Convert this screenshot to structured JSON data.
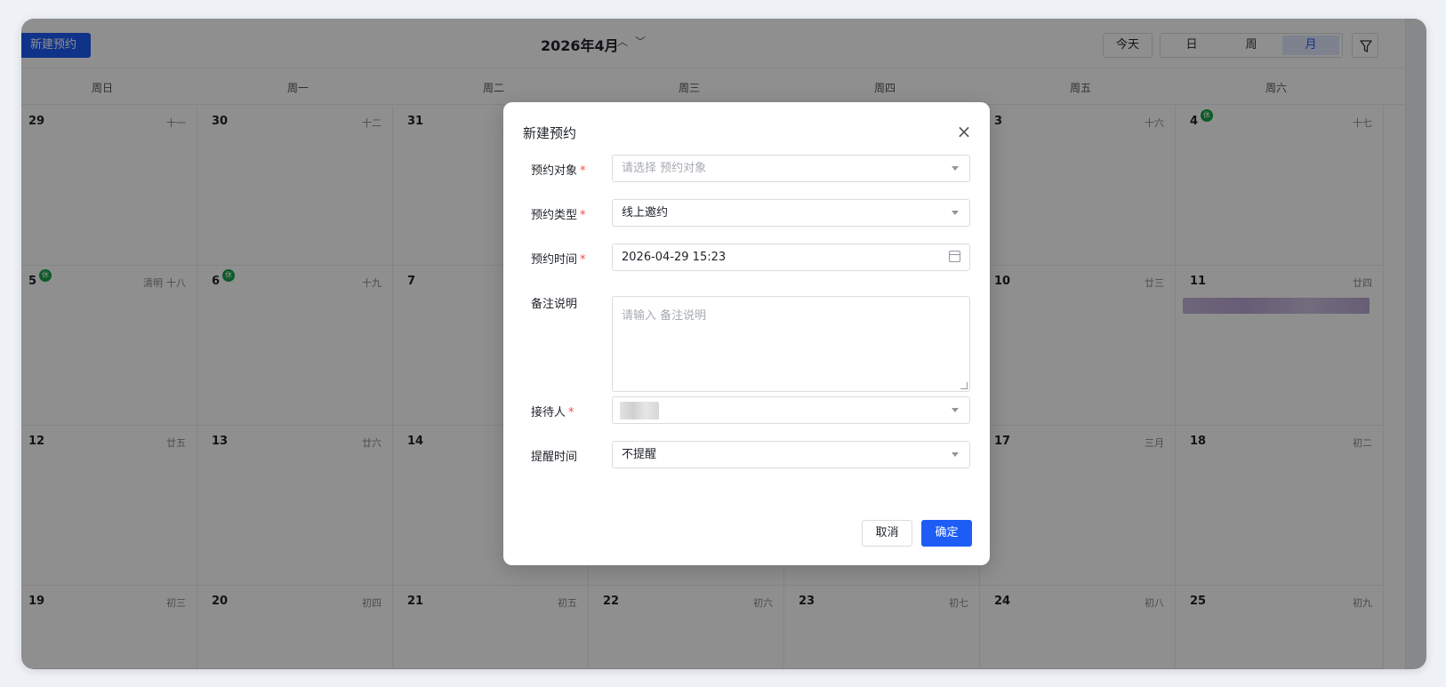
{
  "toolbar": {
    "new_button": "新建预约",
    "month_title": "2026年4月",
    "prev_arrow": "︿",
    "next_arrow": "﹀",
    "today_button": "今天",
    "views": [
      "日",
      "周",
      "月"
    ],
    "active_view": "月"
  },
  "weekdays": [
    "周日",
    "周一",
    "周二",
    "周三",
    "周四",
    "周五",
    "周六"
  ],
  "weeks": [
    [
      {
        "day": "29",
        "lunar": "十一"
      },
      {
        "day": "30",
        "lunar": "十二"
      },
      {
        "day": "31",
        "lunar": ""
      },
      {
        "day": "",
        "lunar": ""
      },
      {
        "day": "",
        "lunar": ""
      },
      {
        "day": "3",
        "lunar": "十六"
      },
      {
        "day": "4",
        "lunar": "十七",
        "badge": "休"
      }
    ],
    [
      {
        "day": "5",
        "lunar": "十八",
        "festival": "清明",
        "badge": "休"
      },
      {
        "day": "6",
        "lunar": "十九",
        "badge": "休"
      },
      {
        "day": "7",
        "lunar": ""
      },
      {
        "day": "",
        "lunar": ""
      },
      {
        "day": "",
        "lunar": ""
      },
      {
        "day": "10",
        "lunar": "廿三"
      },
      {
        "day": "11",
        "lunar": "廿四",
        "has_event": true
      }
    ],
    [
      {
        "day": "12",
        "lunar": "廿五"
      },
      {
        "day": "13",
        "lunar": "廿六"
      },
      {
        "day": "14",
        "lunar": ""
      },
      {
        "day": "",
        "lunar": ""
      },
      {
        "day": "",
        "lunar": ""
      },
      {
        "day": "17",
        "lunar": "三月"
      },
      {
        "day": "18",
        "lunar": "初二"
      }
    ],
    [
      {
        "day": "19",
        "lunar": "初三"
      },
      {
        "day": "20",
        "lunar": "初四"
      },
      {
        "day": "21",
        "lunar": "初五"
      },
      {
        "day": "22",
        "lunar": "初六"
      },
      {
        "day": "23",
        "lunar": "初七"
      },
      {
        "day": "24",
        "lunar": "初八"
      },
      {
        "day": "25",
        "lunar": "初九"
      }
    ]
  ],
  "modal": {
    "title": "新建预约",
    "close_icon": "×",
    "fields": {
      "target": {
        "label": "预约对象",
        "required": "*",
        "placeholder": "请选择 预约对象"
      },
      "type": {
        "label": "预约类型",
        "required": "*",
        "value": "线上邀约"
      },
      "time": {
        "label": "预约时间",
        "required": "*",
        "value": "2026-04-29 15:23"
      },
      "remark": {
        "label": "备注说明",
        "placeholder": "请输入 备注说明"
      },
      "receptionist": {
        "label": "接待人",
        "required": "*"
      },
      "reminder": {
        "label": "提醒时间",
        "value": "不提醒"
      }
    },
    "cancel_button": "取消",
    "ok_button": "确定"
  },
  "colors": {
    "primary": "#1e5cf6",
    "required": "#f54a45",
    "holiday_badge": "#16a34a",
    "overlay": "rgba(0,0,0,0.44)"
  }
}
